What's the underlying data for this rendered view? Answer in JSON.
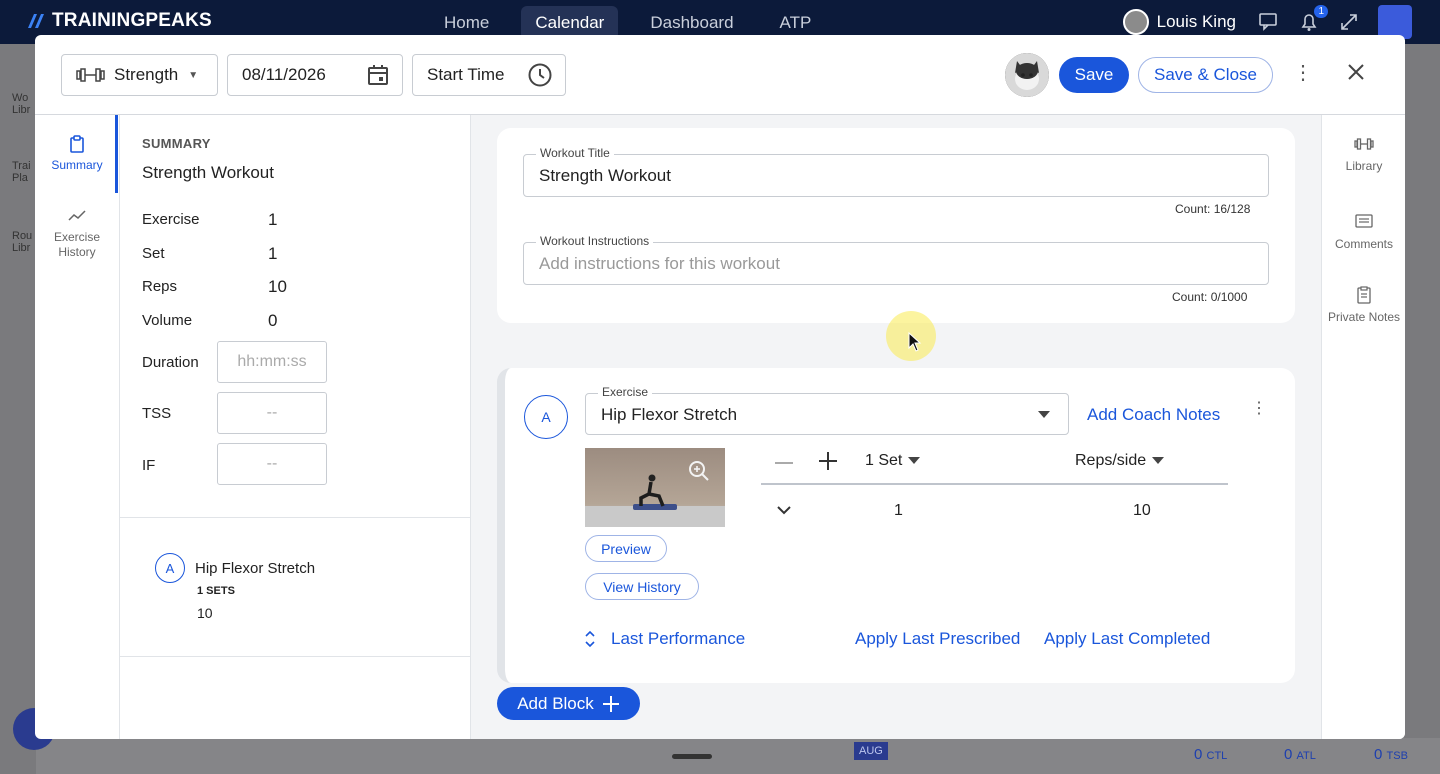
{
  "topbar": {
    "brand": "TRAININGPEAKS",
    "tabs": [
      {
        "label": "Home"
      },
      {
        "label": "Calendar"
      },
      {
        "label": "Dashboard"
      },
      {
        "label": "ATP"
      }
    ],
    "user_name": "Louis King",
    "notification_count": "1"
  },
  "background": {
    "left_labels": [
      "Wo",
      "Libr",
      "Trai",
      "Pla",
      "Rou",
      "Libr"
    ],
    "month_chip": "AUG",
    "stats": [
      {
        "value": "0",
        "unit": "CTL"
      },
      {
        "value": "0",
        "unit": "ATL"
      },
      {
        "value": "0",
        "unit": "TSB"
      }
    ]
  },
  "header": {
    "workout_type": "Strength",
    "date": "08/11/2026",
    "start_time_label": "Start Time",
    "save_label": "Save",
    "save_close_label": "Save & Close"
  },
  "left_rail": {
    "items": [
      {
        "label": "Summary",
        "icon": "clipboard-icon"
      },
      {
        "label": "Exercise History",
        "icon": "trend-line-icon"
      }
    ]
  },
  "summary": {
    "caption": "SUMMARY",
    "title": "Strength Workout",
    "stats": [
      {
        "label": "Exercise",
        "value": "1"
      },
      {
        "label": "Set",
        "value": "1"
      },
      {
        "label": "Reps",
        "value": "10"
      },
      {
        "label": "Volume",
        "value": "0"
      }
    ],
    "inputs": [
      {
        "label": "Duration",
        "placeholder": "hh:mm:ss"
      },
      {
        "label": "TSS",
        "placeholder": "--"
      },
      {
        "label": "IF",
        "placeholder": "--"
      }
    ],
    "exercise": {
      "letter": "A",
      "name": "Hip Flexor Stretch",
      "sets": "1 SETS",
      "reps": "10"
    }
  },
  "workout": {
    "title_label": "Workout Title",
    "title_value": "Strength Workout",
    "title_count": "Count: 16/128",
    "instructions_label": "Workout Instructions",
    "instructions_placeholder": "Add instructions for this workout",
    "instructions_count": "Count: 0/1000"
  },
  "block": {
    "letter": "A",
    "exercise_label": "Exercise",
    "exercise_value": "Hip Flexor Stretch",
    "add_coach_notes": "Add Coach Notes",
    "set_count": "1 Set",
    "reps_header": "Reps/side",
    "rows": [
      {
        "set": "1",
        "reps": "10"
      }
    ],
    "preview_label": "Preview",
    "view_history_label": "View History",
    "last_performance": "Last Performance",
    "apply_last_prescribed": "Apply Last Prescribed",
    "apply_last_completed": "Apply Last Completed"
  },
  "add_block_label": "Add Block",
  "right_rail": {
    "items": [
      {
        "label": "Library",
        "icon": "dumbbell-icon"
      },
      {
        "label": "Comments",
        "icon": "comment-icon"
      },
      {
        "label": "Private Notes",
        "icon": "notes-icon"
      }
    ]
  },
  "colors": {
    "accent": "#1a56db",
    "topbar": "#0c1a3a"
  }
}
